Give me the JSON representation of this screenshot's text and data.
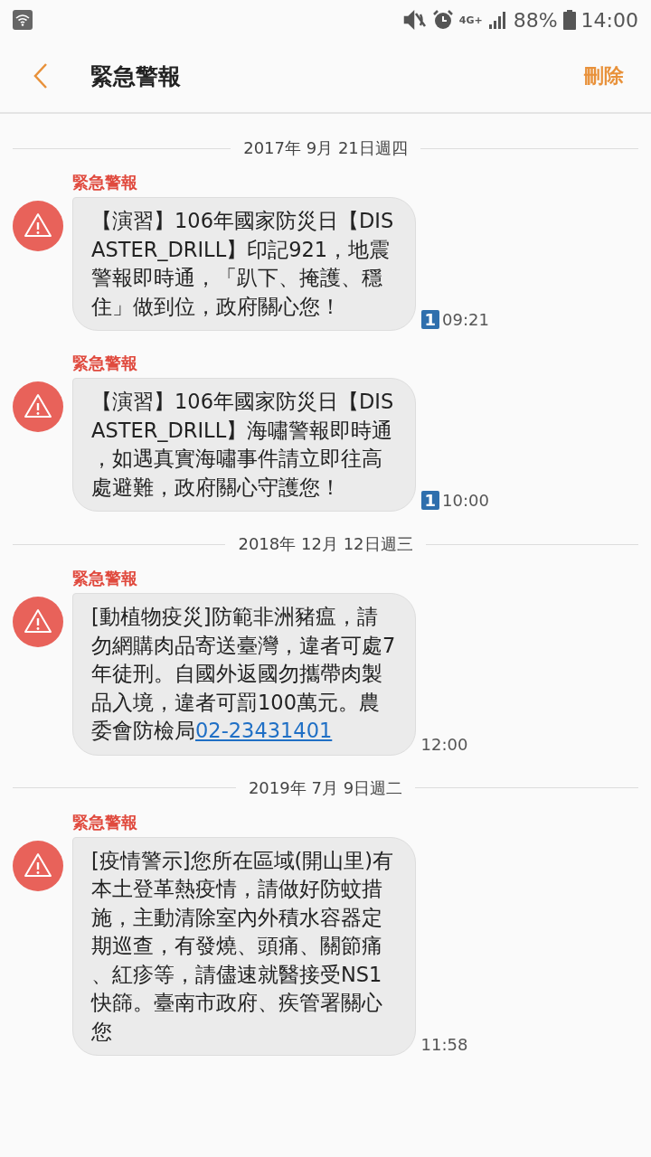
{
  "status_bar": {
    "network": "4G+",
    "battery": "88%",
    "time": "14:00"
  },
  "header": {
    "title": "緊急警報",
    "action": "刪除"
  },
  "groups": [
    {
      "date": "2017年 9月 21日週四",
      "messages": [
        {
          "sender": "緊急警報",
          "text": "【演習】106年國家防災日【DISASTER_DRILL】印記921，地震警報即時通，「趴下、掩護、穩住」做到位，政府關心您！",
          "sim": "1",
          "time": "09:21"
        },
        {
          "sender": "緊急警報",
          "text": "【演習】106年國家防災日【DISASTER_DRILL】海嘯警報即時通，如遇真實海嘯事件請立即往高處避難，政府關心守護您！",
          "sim": "1",
          "time": "10:00"
        }
      ]
    },
    {
      "date": "2018年 12月 12日週三",
      "messages": [
        {
          "sender": "緊急警報",
          "text": "[動植物疫災]防範非洲豬瘟，請勿網購肉品寄送臺灣，違者可處7年徒刑。自國外返國勿攜帶肉製品入境，違者可罰100萬元。農委會防檢局",
          "link": "02-23431401",
          "time": "12:00"
        }
      ]
    },
    {
      "date": "2019年 7月 9日週二",
      "messages": [
        {
          "sender": "緊急警報",
          "text": "[疫情警示]您所在區域(開山里)有本土登革熱疫情，請做好防蚊措施，主動清除室內外積水容器定期巡查，有發燒、頭痛、關節痛、紅疹等，請儘速就醫接受NS1快篩。臺南市政府、疾管署關心您",
          "time": "11:58"
        }
      ]
    }
  ]
}
